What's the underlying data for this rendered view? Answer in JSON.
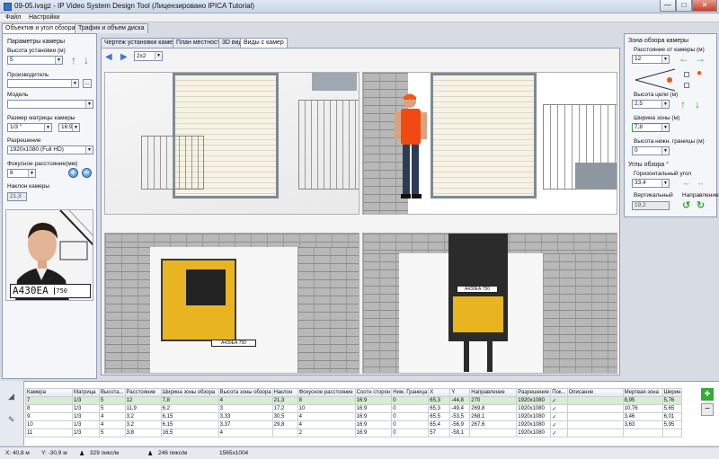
{
  "window": {
    "title": "09-05.ivsgz - IP Video System Design Tool (Лицензировано  IPICA Tutorial)",
    "close": "✕",
    "maximize": "□",
    "minimize": "—"
  },
  "menu": [
    "Файл",
    "Настройки"
  ],
  "left_tabs": [
    "Объектив и угол обзора",
    "Трафик и объем диска"
  ],
  "camera_params": {
    "header": "Параметры камеры",
    "height_label": "Высота установки (м)",
    "height_value": "5",
    "manufacturer_label": "Производитель",
    "manufacturer_value": "",
    "more_btn": "...",
    "model_label": "Модель",
    "model_value": "",
    "matrix_label": "Размер матрицы камеры",
    "matrix_value": "1/3 \"",
    "matrix_ratio": "16:9",
    "resolution_label": "Разрешение",
    "resolution_value": "1920x1080 (Full HD)",
    "focal_label": "Фокусное расстояние(мм)",
    "focal_value": "8",
    "tilt_label": "Наклон камеры",
    "tilt_value": "21,3",
    "plate_text": "А430ЕА",
    "plate_region": "750"
  },
  "center_tabs": [
    "Чертеж установки камеры",
    "План местности",
    "3D вид",
    "Виды с камер"
  ],
  "grid_select": "2x2",
  "views": {
    "plate_bottom_left": "А430ЕА 750",
    "plate_bottom_right": "А430ЕА 750"
  },
  "view_zone": {
    "header": "Зона обзора камеры",
    "distance_label": "Расстояние от камеры (м)",
    "distance_value": "12",
    "target_height_label": "Высота цели (м)",
    "target_height_value": "2,5",
    "zone_width_label": "Ширина зоны (м)",
    "zone_width_value": "7,8",
    "lower_bound_label": "Высота нижн. границы (м)",
    "lower_bound_value": "0"
  },
  "angles": {
    "header": "Углы обзора °",
    "horizontal_label": "Горизонтальный угол",
    "horizontal_value": "33,4",
    "vertical_label": "Вертикальный",
    "vertical_value": "19,2",
    "direction_label": "Направление"
  },
  "table": {
    "headers": [
      "Камера",
      "Матрица",
      "Высота...",
      "Расстояние",
      "Ширина зоны обзора",
      "Высота зоны обзора",
      "Наклон",
      "Фокусное расстояние",
      "Соотн сторон",
      "Ниж. Граница",
      "X",
      "Y",
      "Направление",
      "Разрешение",
      "Пок...",
      "Описание",
      "Мертвая зона",
      "Ширин"
    ],
    "rows": [
      [
        "7",
        "1/3",
        "5",
        "12",
        "7,8",
        "4",
        "21,3",
        "8",
        "16:9",
        "0",
        "65,3",
        "-44,8",
        "270",
        "1920x1080",
        "✓",
        "",
        "8,95",
        "5,76"
      ],
      [
        "8",
        "1/3",
        "5",
        "11,9",
        "6,2",
        "3",
        "17,2",
        "10",
        "16:9",
        "0",
        "65,3",
        "-49,4",
        "269,8",
        "1920x1080",
        "✓",
        "",
        "10,76",
        "5,65"
      ],
      [
        "9",
        "1/3",
        "4",
        "3,2",
        "6,15",
        "3,33",
        "30,5",
        "4",
        "16:9",
        "0",
        "65,5",
        "-53,5",
        "268,1",
        "1920x1080",
        "✓",
        "",
        "3,46",
        "6,01"
      ],
      [
        "10",
        "1/3",
        "4",
        "3,2",
        "6,15",
        "3,37",
        "29,8",
        "4",
        "16:9",
        "0",
        "65,4",
        "-56,9",
        "267,6",
        "1920x1080",
        "✓",
        "",
        "3,63",
        "5,95"
      ],
      [
        "11",
        "1/3",
        "5",
        "3,8",
        "16,5",
        "4",
        "",
        "2",
        "16:9",
        "0",
        "57",
        "-58,1",
        "",
        "1920x1080",
        "✓",
        "",
        "",
        ""
      ]
    ]
  },
  "status": {
    "x": "X: 40,8 м",
    "y": "Y: -30,9 м",
    "density1": "329 пикс/м",
    "density2": "246 пикс/м",
    "resolution": "1565x1004"
  },
  "colors": {
    "accent_blue": "#2f7fd6",
    "green": "#3aa83a",
    "selected_row": "#d7ecd0"
  }
}
